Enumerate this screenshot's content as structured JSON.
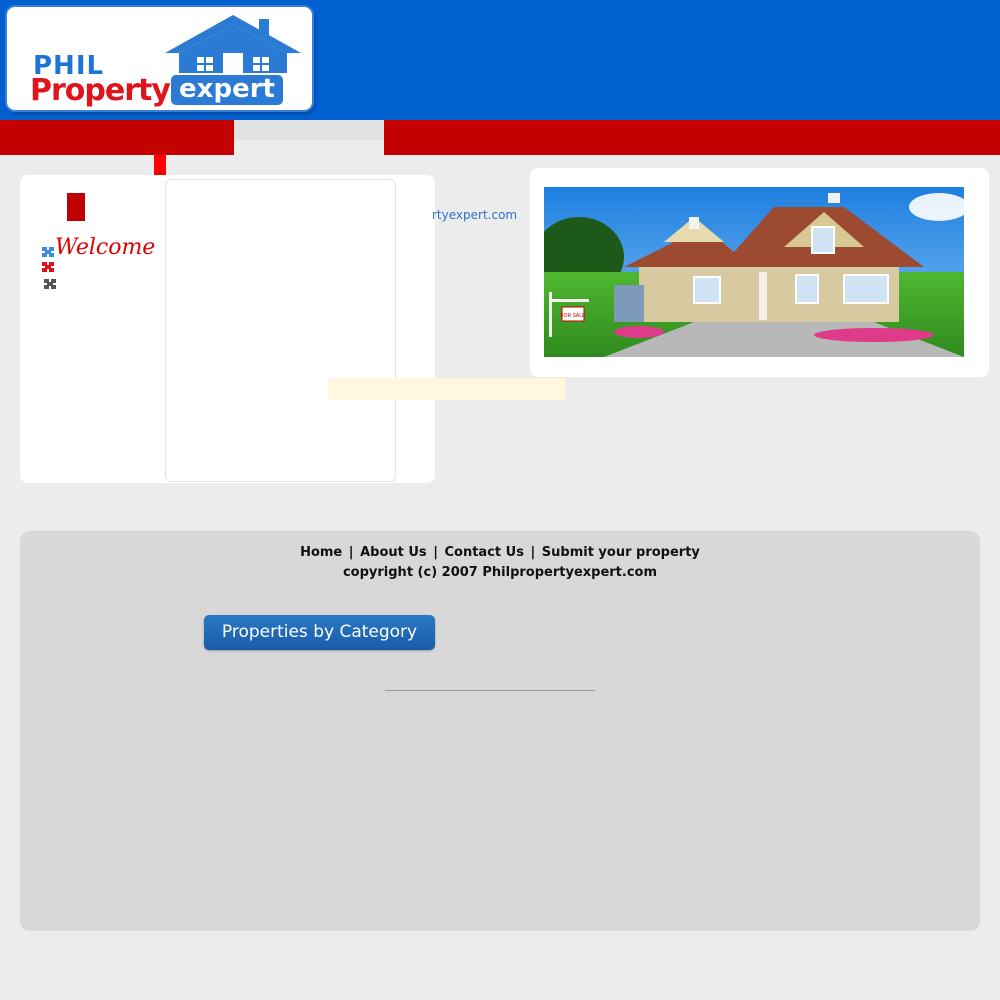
{
  "header": {
    "logo_phil": "PHIL",
    "logo_property": "Property",
    "logo_expert": "expert",
    "brand_blue": "#0060d0",
    "brand_red": "#c40000"
  },
  "main": {
    "welcome": "Welcome",
    "url_fragment": "rtyexpert.com"
  },
  "footer": {
    "links": [
      "Home",
      "About Us",
      "Contact Us",
      "Submit your property"
    ],
    "separator": "|",
    "copyright": "copyright (c) 2007 Philpropertyexpert.com",
    "category_button": "Properties by Category"
  },
  "images": {
    "house_sign": "FOR SALE"
  }
}
